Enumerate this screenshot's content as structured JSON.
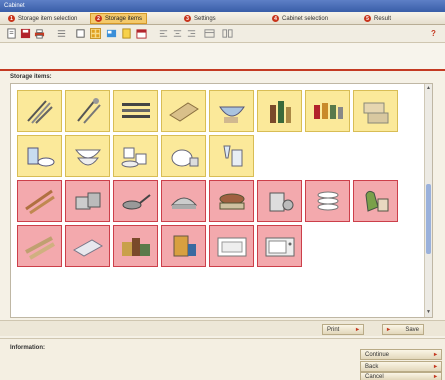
{
  "window": {
    "title": "Cabinet"
  },
  "wizard": {
    "tabs": [
      {
        "label": "Storage item selection",
        "number": "1",
        "active": false
      },
      {
        "label": "Storage items",
        "number": "2",
        "active": true
      },
      {
        "label": "Settings",
        "number": "3",
        "active": false
      },
      {
        "label": "Cabinet selection",
        "number": "4",
        "active": false
      },
      {
        "label": "Result",
        "number": "5",
        "active": false
      }
    ]
  },
  "toolbar": {
    "icons": [
      "new-icon",
      "save-icon",
      "print-icon",
      "list-icon",
      "view-large-icon",
      "view-grid-icon",
      "view-detail-icon",
      "document-icon",
      "calendar-icon",
      "align-left-icon",
      "align-center-icon",
      "align-right-icon",
      "table-icon",
      "columns-icon",
      "help-icon"
    ],
    "help_label": "?"
  },
  "section": {
    "label": "Storage items:"
  },
  "tiles": [
    {
      "icon": "cutlery-icon",
      "color": "yellow"
    },
    {
      "icon": "utensils-icon",
      "color": "yellow"
    },
    {
      "icon": "knives-icon",
      "color": "yellow"
    },
    {
      "icon": "cutting-board-icon",
      "color": "yellow"
    },
    {
      "icon": "mixing-bowl-icon",
      "color": "yellow"
    },
    {
      "icon": "bottles-icon",
      "color": "yellow"
    },
    {
      "icon": "spice-jars-icon",
      "color": "yellow"
    },
    {
      "icon": "food-containers-icon",
      "color": "yellow"
    },
    {
      "icon": "tea-set-icon",
      "color": "yellow"
    },
    {
      "icon": "bowls-icon",
      "color": "yellow"
    },
    {
      "icon": "coffee-cups-icon",
      "color": "yellow"
    },
    {
      "icon": "teapot-icon",
      "color": "yellow"
    },
    {
      "icon": "glassware-icon",
      "color": "yellow"
    },
    {
      "icon": "rolling-pins-icon",
      "color": "red"
    },
    {
      "icon": "pots-icon",
      "color": "red"
    },
    {
      "icon": "pans-icon",
      "color": "red"
    },
    {
      "icon": "roaster-icon",
      "color": "red"
    },
    {
      "icon": "casserole-icon",
      "color": "red"
    },
    {
      "icon": "kitchen-appliance-icon",
      "color": "red"
    },
    {
      "icon": "plates-icon",
      "color": "red"
    },
    {
      "icon": "oven-mitts-icon",
      "color": "red"
    },
    {
      "icon": "baking-rolls-icon",
      "color": "red"
    },
    {
      "icon": "foil-roll-icon",
      "color": "red"
    },
    {
      "icon": "groceries-icon",
      "color": "red"
    },
    {
      "icon": "cereal-box-icon",
      "color": "red"
    },
    {
      "icon": "oven-tray-icon",
      "color": "red"
    },
    {
      "icon": "microwave-icon",
      "color": "red"
    }
  ],
  "colors": {
    "accent": "#c43a22",
    "tile_yellow": "#fbe99a",
    "tile_red": "#f3a9ad",
    "active_tab": "#f4c96a"
  },
  "actions": {
    "print_label": "Print",
    "save_label": "Save"
  },
  "info": {
    "label": "Information:"
  },
  "nav": {
    "continue_label": "Continue",
    "back_label": "Back",
    "cancel_label": "Cancel"
  }
}
